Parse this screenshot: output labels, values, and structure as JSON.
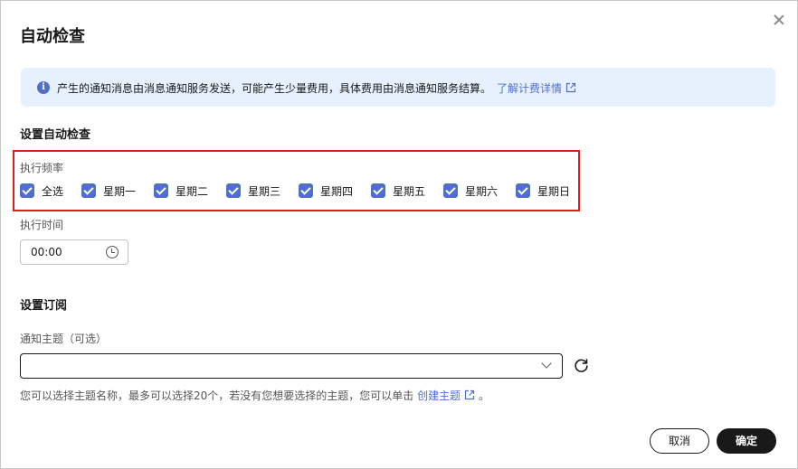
{
  "dialog": {
    "title": "自动检查"
  },
  "banner": {
    "text": "产生的通知消息由消息通知服务发送，可能产生少量费用，具体费用由消息通知服务结算。",
    "link": "了解计费详情"
  },
  "auto_check": {
    "section_title": "设置自动检查",
    "frequency_label": "执行频率",
    "options": [
      {
        "label": "全选",
        "checked": true
      },
      {
        "label": "星期一",
        "checked": true
      },
      {
        "label": "星期二",
        "checked": true
      },
      {
        "label": "星期三",
        "checked": true
      },
      {
        "label": "星期四",
        "checked": true
      },
      {
        "label": "星期五",
        "checked": true
      },
      {
        "label": "星期六",
        "checked": true
      },
      {
        "label": "星期日",
        "checked": true
      }
    ],
    "time_label": "执行时间",
    "time_value": "00:00"
  },
  "subscription": {
    "section_title": "设置订阅",
    "topic_label": "通知主题（可选）",
    "topic_value": "",
    "helper_text": "您可以选择主题名称，最多可以选择20个，若没有您想要选择的主题，您可以单击",
    "helper_link": "创建主题",
    "helper_end": "。"
  },
  "footer": {
    "cancel_label": "取消",
    "ok_label": "确定"
  },
  "colors": {
    "accent": "#526ecc",
    "banner_bg": "#e6f1fd",
    "highlight": "#e02020",
    "primary_button": "#191919"
  }
}
